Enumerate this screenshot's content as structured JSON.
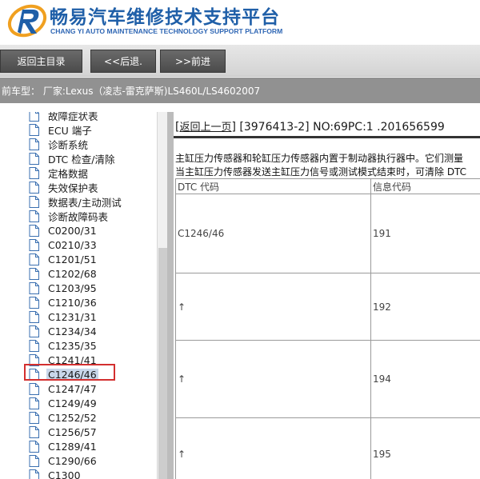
{
  "header": {
    "title_cn": "畅易汽车维修技术支持平台",
    "title_en": "CHANG YI AUTO MAINTENANCE TECHNOLOGY SUPPORT PLATFORM"
  },
  "nav": {
    "home": "返回主目录",
    "back": "<<后退.",
    "forward": ">>前进"
  },
  "vehicle": {
    "text": "前车型：  厂家:Lexus（凌志-雷克萨斯)LS460L/LS4602007"
  },
  "tree": {
    "items": [
      {
        "label": "故障症状表"
      },
      {
        "label": "ECU 端子"
      },
      {
        "label": "诊断系统"
      },
      {
        "label": "DTC 检查/清除"
      },
      {
        "label": "定格数据"
      },
      {
        "label": "失效保护表"
      },
      {
        "label": "数据表/主动测试"
      },
      {
        "label": "诊断故障码表"
      },
      {
        "label": "C0200/31"
      },
      {
        "label": "C0210/33"
      },
      {
        "label": "C1201/51"
      },
      {
        "label": "C1202/68"
      },
      {
        "label": "C1203/95"
      },
      {
        "label": "C1210/36"
      },
      {
        "label": "C1231/31"
      },
      {
        "label": "C1234/34"
      },
      {
        "label": "C1235/35"
      },
      {
        "label": "C1241/41"
      },
      {
        "label": "C1246/46"
      },
      {
        "label": "C1247/47"
      },
      {
        "label": "C1249/49"
      },
      {
        "label": "C1252/52"
      },
      {
        "label": "C1256/57"
      },
      {
        "label": "C1289/41"
      },
      {
        "label": "C1290/66"
      },
      {
        "label": "C1300"
      }
    ],
    "selected_index": 18
  },
  "content": {
    "back_link": "返回上一页",
    "doc_info": "[3976413-2] NO:69PC:1 .201656599",
    "desc_line1": "主缸压力传感器和轮缸压力传感器内置于制动器执行器中。它们测量",
    "desc_line2": "当主缸压力传感器发送主缸压力信号或测试模式结束时，可清除 DTC",
    "table": {
      "headers": [
        "DTC 代码",
        "信息代码"
      ],
      "rows": [
        {
          "dtc": "C1246/46",
          "info": "191"
        },
        {
          "dtc": "↑",
          "info": "192"
        },
        {
          "dtc": "↑",
          "info": "194"
        },
        {
          "dtc": "↑",
          "info": "195"
        }
      ]
    }
  },
  "colors": {
    "title": "#1f5fa8",
    "nav_button": "#555555",
    "vehicle_bar": "#919191",
    "highlight": "#d32f2f",
    "selection": "#c9d7ea"
  }
}
